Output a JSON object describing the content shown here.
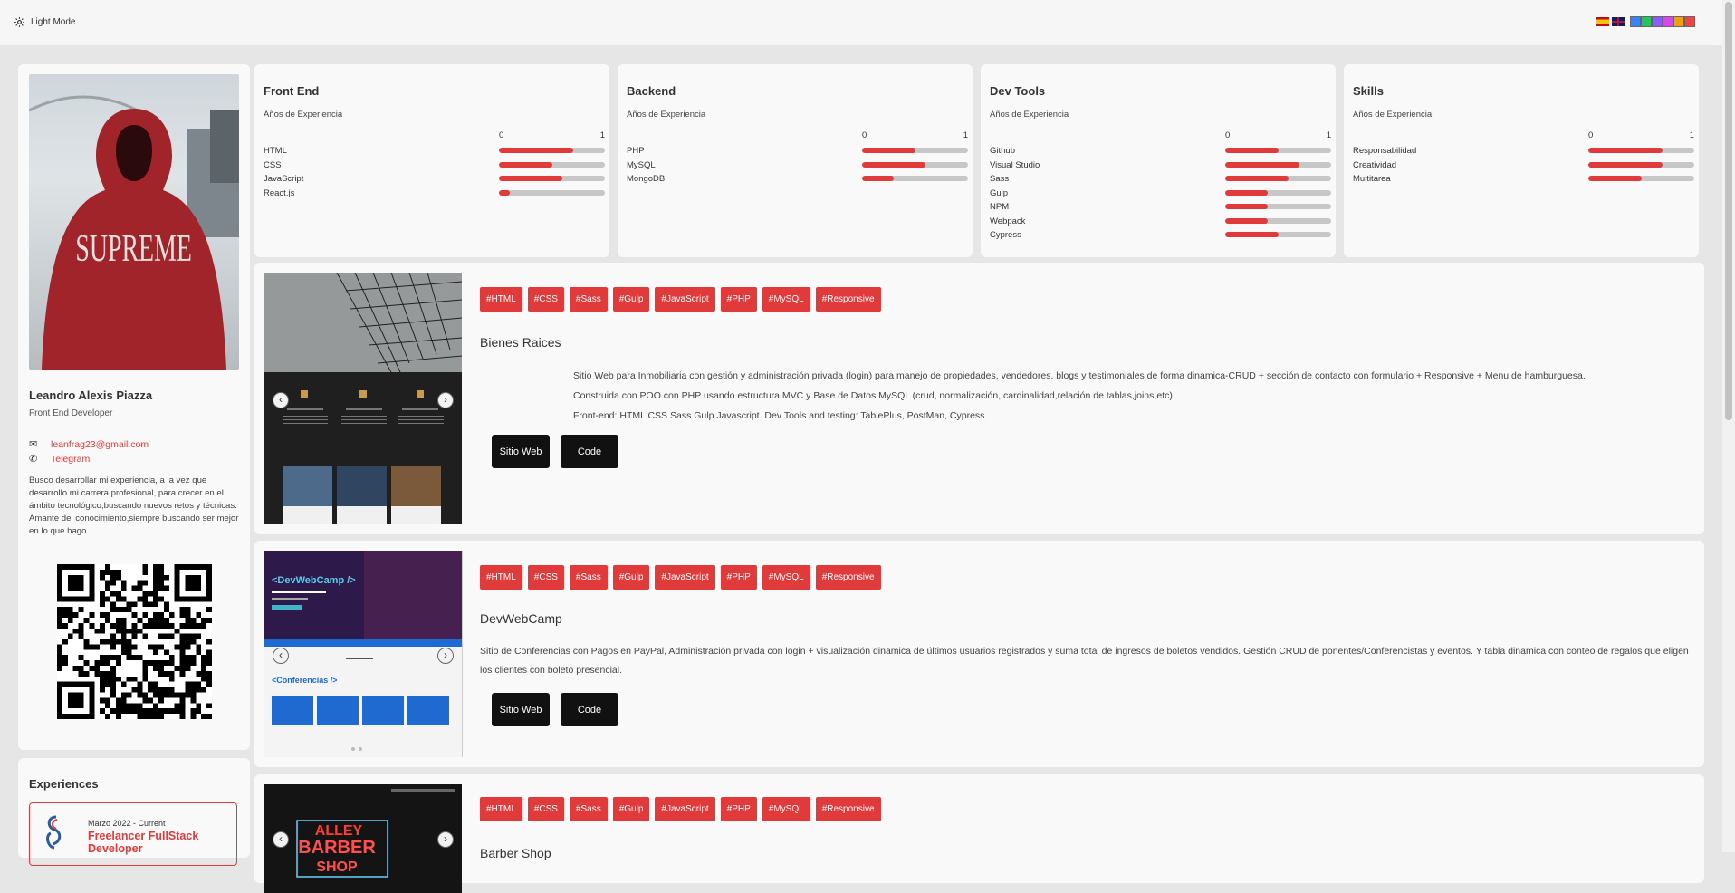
{
  "topbar": {
    "mode_label": "Light Mode",
    "theme_colors": [
      "#3b82f6",
      "#22c55e",
      "#8b5cf6",
      "#d946ef",
      "#f59e0b",
      "#ef4444"
    ]
  },
  "profile": {
    "name": "Leandro Alexis Piazza",
    "role": "Front End Developer",
    "email": "leanfrag23@gmail.com",
    "telegram": "Telegram",
    "about": "Busco desarrollar mi experiencia, a la vez que desarrollo mi carrera profesional, para crecer en el ámbito tecnológico,buscando nuevos retos y técnicas. Amante del conocimiento,siempre buscando ser mejor en lo que hago.",
    "photo_text": "SUPREME"
  },
  "experiences": {
    "title": "Experiences",
    "items": [
      {
        "date": "Marzo 2022 - Current",
        "job": "Freelancer FullStack Developer"
      }
    ]
  },
  "skills": {
    "subtitle": "Años de Experiencia",
    "scale_min": "0",
    "scale_max": "1",
    "groups": [
      {
        "title": "Front End",
        "items": [
          {
            "label": "HTML",
            "value": 0.7
          },
          {
            "label": "CSS",
            "value": 0.5
          },
          {
            "label": "JavaScript",
            "value": 0.6
          },
          {
            "label": "React.js",
            "value": 0.1
          }
        ]
      },
      {
        "title": "Backend",
        "items": [
          {
            "label": "PHP",
            "value": 0.5
          },
          {
            "label": "MySQL",
            "value": 0.6
          },
          {
            "label": "MongoDB",
            "value": 0.3
          }
        ]
      },
      {
        "title": "Dev Tools",
        "items": [
          {
            "label": "Github",
            "value": 0.5
          },
          {
            "label": "Visual Studio",
            "value": 0.7
          },
          {
            "label": "Sass",
            "value": 0.6
          },
          {
            "label": "Gulp",
            "value": 0.4
          },
          {
            "label": "NPM",
            "value": 0.4
          },
          {
            "label": "Webpack",
            "value": 0.4
          },
          {
            "label": "Cypress",
            "value": 0.5
          }
        ]
      },
      {
        "title": "Skills",
        "items": [
          {
            "label": "Responsabilidad",
            "value": 0.7
          },
          {
            "label": "Creatividad",
            "value": 0.7
          },
          {
            "label": "Multitarea",
            "value": 0.5
          }
        ]
      }
    ]
  },
  "projects": [
    {
      "tags": [
        "#HTML",
        "#CSS",
        "#Sass",
        "#Gulp",
        "#JavaScript",
        "#PHP",
        "#MySQL",
        "#Responsive"
      ],
      "title": "Bienes Raices",
      "description": [
        "Sitio Web para Inmobiliaria con gestión y administración privada (login) para manejo de propiedades, vendedores, blogs y testimoniales de forma dinamica-CRUD + sección de contacto con formulario + Responsive + Menu de hamburguesa.",
        "Construida con POO con PHP usando estructura MVC y Base de Datos MySQL (crud, normalización, cardinalidad,relación de tablas,joins,etc).",
        "Front-end: HTML CSS Sass Gulp Javascript. Dev Tools and testing: TablePlus, PostMan, Cypress."
      ],
      "site_label": "Sitio Web",
      "code_label": "Code"
    },
    {
      "tags": [
        "#HTML",
        "#CSS",
        "#Sass",
        "#Gulp",
        "#JavaScript",
        "#PHP",
        "#MySQL",
        "#Responsive"
      ],
      "title": "DevWebCamp",
      "description": [
        "Sitio de Conferencias con Pagos en PayPal, Administración privada con login + visualización dinamica de últimos usuarios registrados y suma total de ingresos de boletos vendidos. Gestión CRUD de ponentes/Conferencistas y eventos. Y tabla dinamica con conteo de regalos que eligen los clientes con boleto presencial."
      ],
      "site_label": "Sitio Web",
      "code_label": "Code",
      "screenshot_texts": {
        "heading": "<DevWebCamp />",
        "section": "<Conferencias />"
      }
    },
    {
      "tags": [
        "#HTML",
        "#CSS",
        "#Sass",
        "#Gulp",
        "#JavaScript",
        "#PHP",
        "#MySQL",
        "#Responsive"
      ],
      "title": "Barber Shop",
      "screenshot_texts": {
        "sign_top": "ALLEY",
        "sign_mid": "BARBER",
        "sign_bottom": "SHOP"
      }
    }
  ]
}
